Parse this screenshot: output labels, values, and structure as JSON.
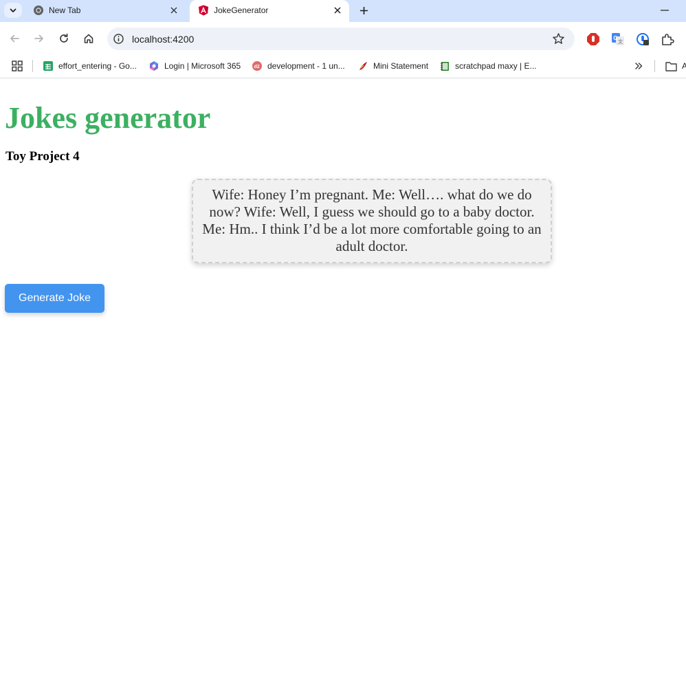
{
  "browser": {
    "tabs": [
      {
        "title": "New Tab",
        "active": false,
        "icon": "chrome-icon"
      },
      {
        "title": "JokeGenerator",
        "active": true,
        "icon": "angular-icon"
      }
    ],
    "address_bar": {
      "url": "localhost:4200"
    },
    "bookmarks": [
      {
        "label": "effort_entering - Go...",
        "icon": "google-sheets-icon"
      },
      {
        "label": "Login | Microsoft 365",
        "icon": "microsoft-365-icon"
      },
      {
        "label": "development - 1 un...",
        "icon": "development-icon"
      },
      {
        "label": "Mini Statement",
        "icon": "mini-statement-icon"
      },
      {
        "label": "scratchpad maxy | E...",
        "icon": "notebook-icon"
      }
    ],
    "bookmarks_overflow_folder": "A"
  },
  "page": {
    "title": "Jokes generator",
    "subtitle": "Toy Project 4",
    "joke": "Wife: Honey I’m pregnant. Me: Well…. what do we do now? Wife: Well, I guess we should go to a baby doctor. Me: Hm.. I think I’d be a lot more comfortable going to an adult doctor.",
    "generate_button_label": "Generate Joke"
  },
  "colors": {
    "title_green": "#3cb061",
    "button_blue": "#4394ef",
    "tabstrip": "#d3e3fd",
    "joke_box_bg": "#f1f1f1"
  }
}
